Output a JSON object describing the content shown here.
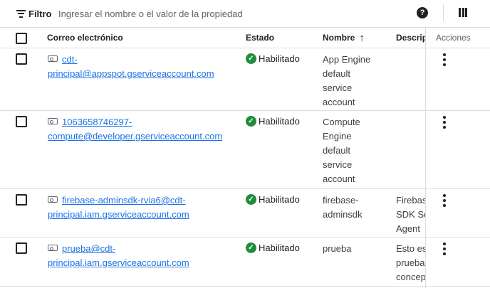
{
  "toolbar": {
    "filter_label": "Filtro",
    "filter_icon": "filter-list-icon",
    "search_placeholder": "Ingresar el nombre o el valor de la propiedad",
    "help_icon": "help-icon",
    "help_glyph": "?",
    "columns_icon": "column-display-icon"
  },
  "columns": {
    "email": "Correo electrónico",
    "status": "Estado",
    "name": "Nombre",
    "name_sort": "↑",
    "description": "Descripción",
    "actions": "Acciones"
  },
  "rows": [
    {
      "email_lines": [
        "cdt-",
        "principal@appspot.gserviceaccount.com"
      ],
      "status": "Habilitado",
      "name_lines": [
        "App Engine",
        "default",
        "service",
        "account"
      ],
      "desc_lines": []
    },
    {
      "email_lines": [
        "1063658746297-",
        "compute@developer.gserviceaccount.com"
      ],
      "status": "Habilitado",
      "name_lines": [
        "Compute",
        "Engine",
        "default",
        "service",
        "account"
      ],
      "desc_lines": []
    },
    {
      "email_lines": [
        "firebase-adminsdk-rvia6@cdt-",
        "principal.iam.gserviceaccount.com"
      ],
      "status": "Habilitado",
      "name_lines": [
        "firebase-",
        "adminsdk"
      ],
      "desc_lines": [
        "Firebas",
        "SDK Se",
        "Agent"
      ]
    },
    {
      "email_lines": [
        "prueba@cdt-",
        "principal.iam.gserviceaccount.com"
      ],
      "status": "Habilitado",
      "name_lines": [
        "prueba"
      ],
      "desc_lines": [
        "Esto es",
        "prueba",
        "concep"
      ]
    }
  ],
  "colors": {
    "link": "#1a73e8",
    "enabled": "#1e8e3e",
    "divider": "#dadce0"
  }
}
